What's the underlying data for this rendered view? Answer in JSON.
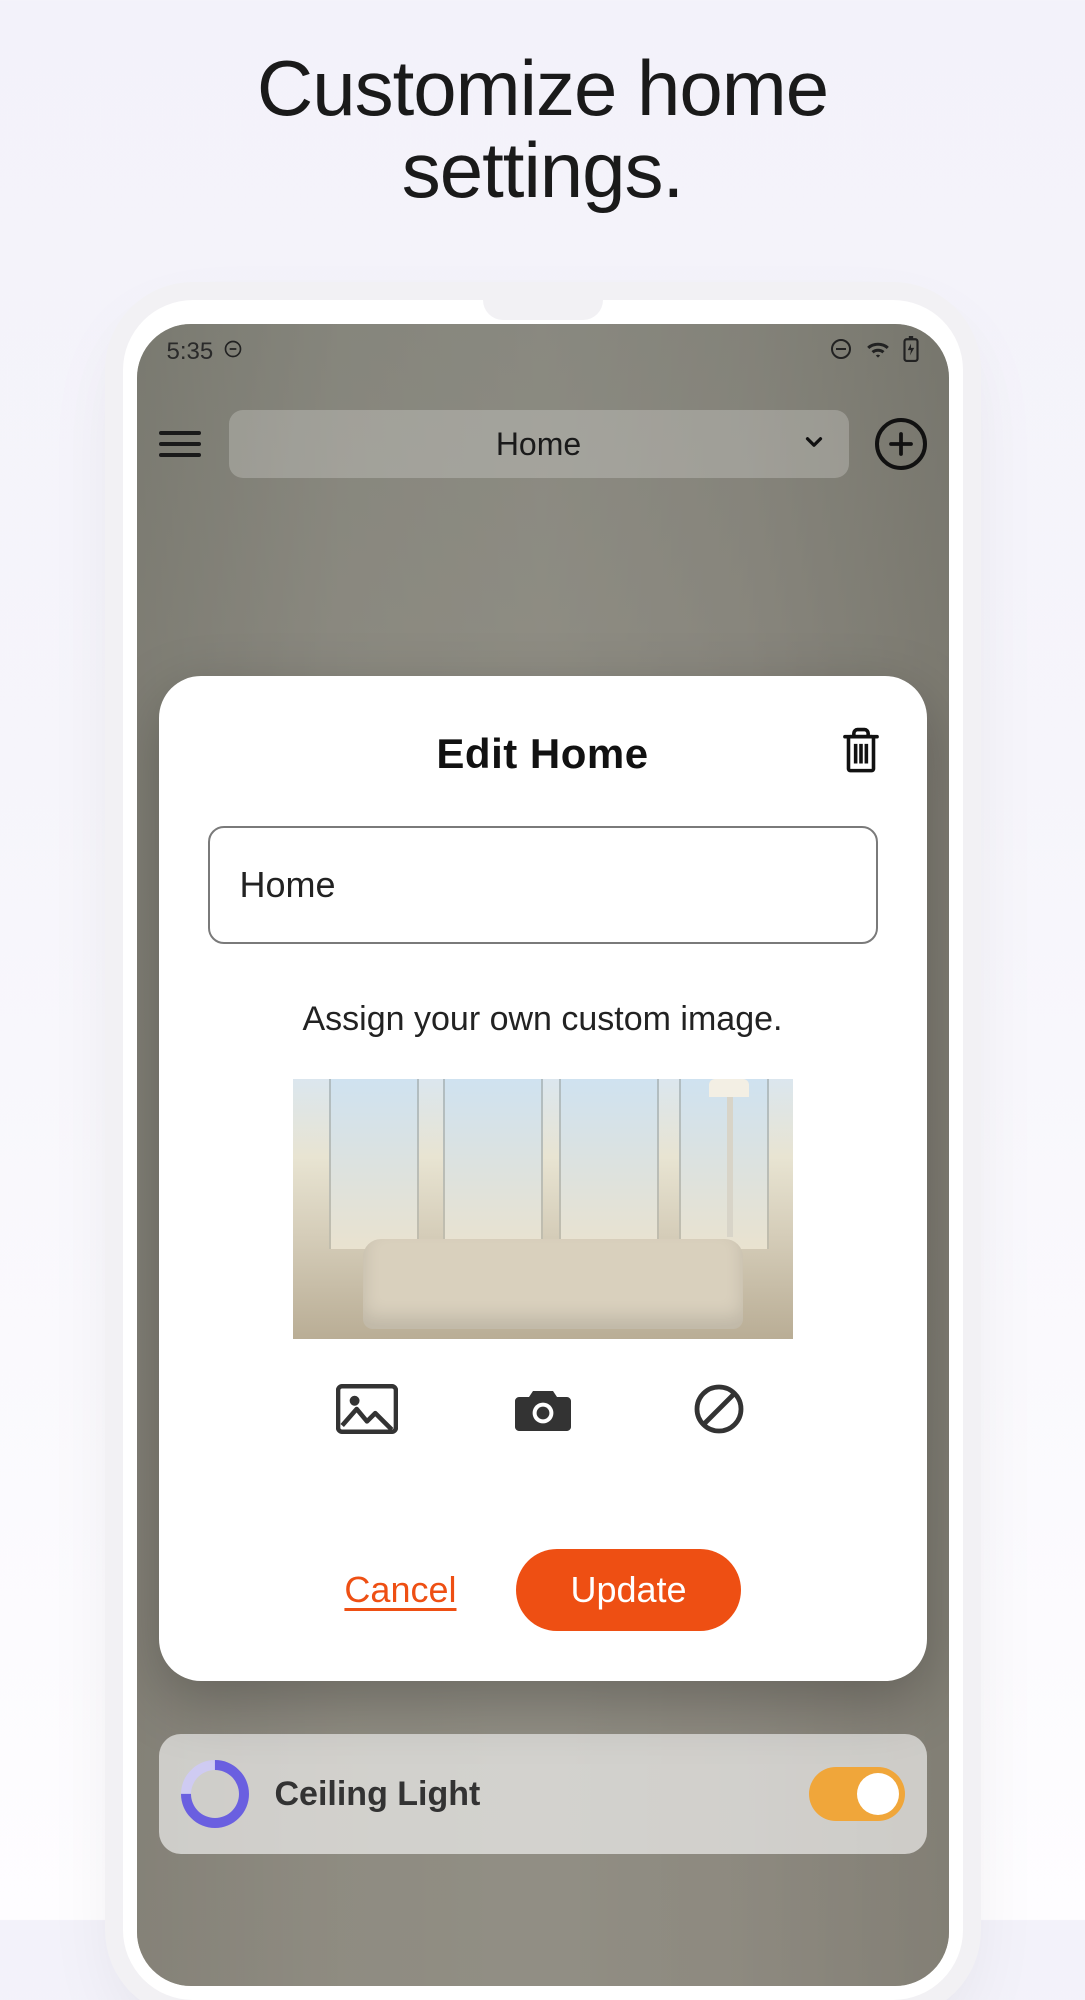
{
  "marketing": {
    "headline_line1": "Customize home",
    "headline_line2": "settings."
  },
  "status_bar": {
    "time": "5:35"
  },
  "header": {
    "home_selector_label": "Home"
  },
  "modal": {
    "title": "Edit Home",
    "name_value": "Home",
    "assign_label": "Assign your own custom image.",
    "cancel_label": "Cancel",
    "update_label": "Update"
  },
  "peek_item": {
    "label": "Ceiling Light"
  },
  "colors": {
    "accent": "#ee4f13"
  }
}
